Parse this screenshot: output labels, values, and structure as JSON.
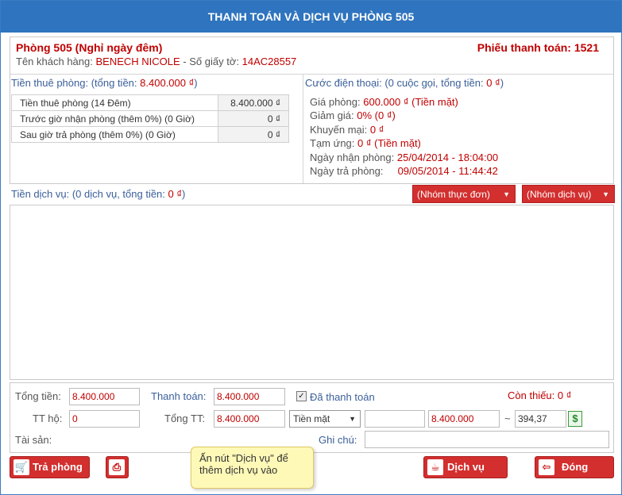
{
  "title": "THANH TOÁN VÀ DỊCH VỤ PHÒNG 505",
  "room": {
    "heading": "Phòng 505 (Nghỉ ngày đêm)",
    "bill_label": "Phiếu thanh toán: 1521",
    "customer_label": "Tên khách hàng:",
    "customer_name": "BENECH NICOLE",
    "doc_label": "- Số giấy tờ:",
    "doc_no": "14AC28557"
  },
  "rent": {
    "head_prefix": "Tiền thuê phòng: (tổng tiền:",
    "head_total": "8.400.000 ₫",
    "head_suffix": ")",
    "rows": [
      {
        "label": "Tiền thuê phòng (14 Đêm)",
        "value": "8.400.000 ₫"
      },
      {
        "label": "Trước giờ nhận phòng (thêm 0%) (0 Giờ)",
        "value": "0 ₫"
      },
      {
        "label": "Sau giờ trả phòng (thêm 0%) (0 Giờ)",
        "value": "0 ₫"
      }
    ]
  },
  "phone": {
    "head_prefix": "Cước điện thoại: (0 cuộc gọi, tổng tiền:",
    "head_total": "0 ₫",
    "head_suffix": ")"
  },
  "details": [
    {
      "label": "Giá phòng:",
      "value": "600.000 ₫ (Tiền mặt)"
    },
    {
      "label": "Giảm giá:",
      "value": "0% (0 ₫)"
    },
    {
      "label": "Khuyến mại:",
      "value": "0 ₫"
    },
    {
      "label": "Tạm ứng:",
      "value": "0 ₫ (Tiền mặt)"
    },
    {
      "label": "Ngày nhận phòng:",
      "value": "25/04/2014 - 18:04:00"
    },
    {
      "label": "Ngày trả phòng:",
      "value": "09/05/2014 - 11:44:42"
    }
  ],
  "service": {
    "head_prefix": "Tiền dịch vụ: (0 dịch vụ, tổng tiền:",
    "head_total": "0 ₫",
    "head_suffix": ")",
    "menu_group": "(Nhóm thực đơn)",
    "service_group": "(Nhóm dịch vụ)"
  },
  "totals": {
    "tong_tien_label": "Tổng tiền:",
    "tong_tien": "8.400.000",
    "thanh_toan_label": "Thanh toán:",
    "thanh_toan": "8.400.000",
    "paid_label": "Đã thanh toán",
    "con_thieu_label": "Còn thiếu:",
    "con_thieu": "0 ₫",
    "tt_ho_label": "TT hộ:",
    "tt_ho": "0",
    "tong_tt_label": "Tổng TT:",
    "tong_tt": "8.400.000",
    "payment_method": "Tiền mặt",
    "extra_field": "",
    "amount": "8.400.000",
    "tilde": "~",
    "converted": "394,37",
    "money_symbol": "$",
    "tai_san_label": "Tài sản:",
    "ghi_chu_label": "Ghi chú:",
    "ghi_chu": ""
  },
  "buttons": {
    "checkout": "Trả phòng",
    "service": "Dịch vụ",
    "close": "Đóng"
  },
  "tooltip": "Ấn nút \"Dịch vụ\" để thêm dịch vụ vào"
}
